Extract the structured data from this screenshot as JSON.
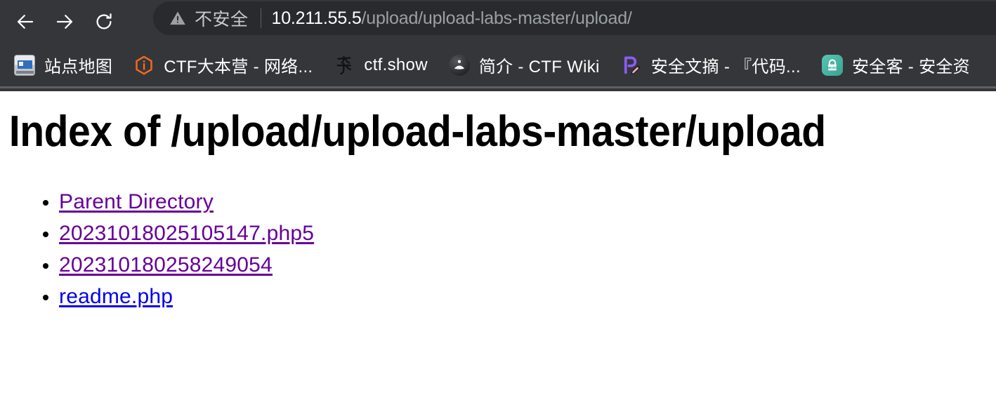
{
  "browser": {
    "nav": {
      "back_label": "Back",
      "back_icon": "arrow-left-icon",
      "forward_label": "Forward",
      "forward_icon": "arrow-right-icon",
      "reload_label": "Reload",
      "reload_icon": "reload-icon"
    },
    "omnibox": {
      "security_icon": "warning-triangle-icon",
      "security_text": "不安全",
      "url_host": "10.211.55.5",
      "url_path": "/upload/upload-labs-master/upload/",
      "full_url": "10.211.55.5/upload/upload-labs-master/upload/"
    },
    "bookmarks": [
      {
        "label": "站点地图",
        "icon": "sitemap-icon"
      },
      {
        "label": "CTF大本营 - 网络...",
        "icon": "ctf-hexagon-icon"
      },
      {
        "label": "ctf.show",
        "icon": "ctfshow-xiu-icon"
      },
      {
        "label": "简介 - CTF Wiki",
        "icon": "ctf-wiki-book-icon"
      },
      {
        "label": "安全文摘 - 『代码...",
        "icon": "purple-p-pencil-icon"
      },
      {
        "label": "安全客 - 安全资",
        "icon": "anquanke-lock-news-icon"
      }
    ]
  },
  "page": {
    "title": "Index of /upload/upload-labs-master/upload",
    "entries": [
      {
        "label": "Parent Directory",
        "state": "visited"
      },
      {
        "label": "20231018025105147.php5",
        "state": "visited"
      },
      {
        "label": "202310180258249054",
        "state": "visited"
      },
      {
        "label": "readme.php",
        "state": "unvisited"
      }
    ]
  },
  "colors": {
    "chrome_bg": "#35363a",
    "omnibox_bg": "#292a2d",
    "visited_link": "#660099",
    "unvisited_link": "#0000ee",
    "page_bg": "#ffffff"
  }
}
